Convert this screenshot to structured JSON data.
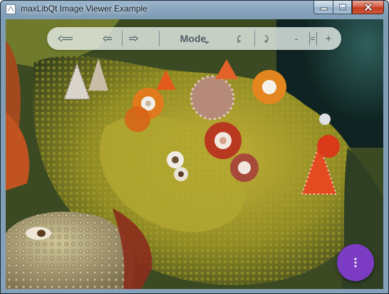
{
  "window": {
    "title": "maxLibQt Image Viewer Example"
  },
  "caption_buttons": {
    "minimize_icon": "minimize-icon",
    "maximize_icon": "maximize-icon",
    "close_icon": "close-icon"
  },
  "toolbar": {
    "back_icon": "arrow-left-long-icon",
    "prev_icon": "skip-back-icon",
    "next_icon": "skip-forward-icon",
    "mode_label": "Mode",
    "rotate_left_icon": "rotate-ccw-icon",
    "rotate_right_icon": "rotate-cw-icon",
    "zoom_out_label": "-",
    "zoom_reset_label": "=",
    "zoom_in_label": "+"
  },
  "fab": {
    "icon": "more-vertical-icon"
  },
  "colors": {
    "fab": "#7b3cc3",
    "toolbar_bg": "#e8f0ec",
    "close_button": "#c23b1f"
  }
}
